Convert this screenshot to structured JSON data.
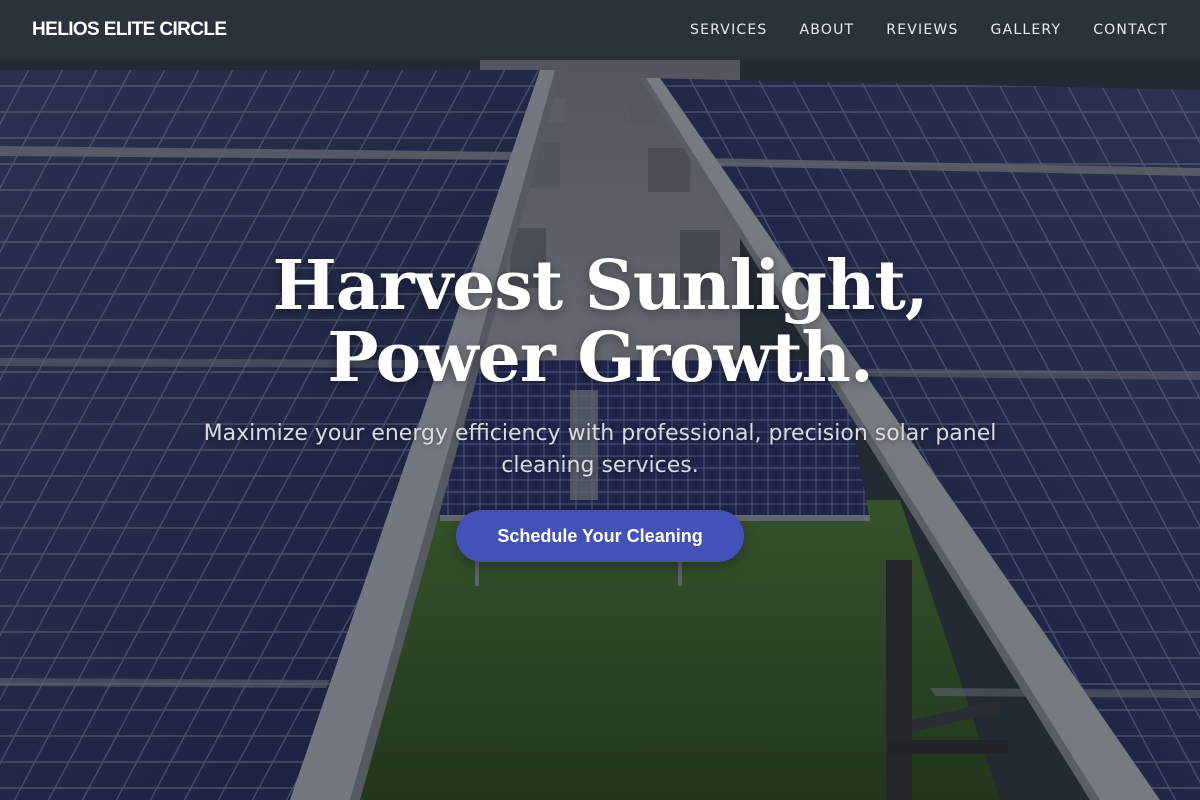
{
  "brand": {
    "name": "HELIOS ELITE CIRCLE"
  },
  "nav": {
    "items": [
      {
        "label": "SERVICES"
      },
      {
        "label": "ABOUT"
      },
      {
        "label": "REVIEWS"
      },
      {
        "label": "GALLERY"
      },
      {
        "label": "CONTACT"
      }
    ]
  },
  "hero": {
    "title": "Harvest Sunlight, Power Growth.",
    "subtitle": "Maximize your energy efficiency with professional, precision solar panel cleaning services.",
    "cta_label": "Schedule Your Cleaning",
    "background_image": "solar-panels-field-photo"
  },
  "colors": {
    "navbar_bg": "#2b323b",
    "cta_bg": "#4452b8",
    "text_white": "#ffffff",
    "subtitle_text": "#d9dbe2",
    "panel_blue": "#2a3468",
    "grass_green": "#3f6a2a"
  }
}
